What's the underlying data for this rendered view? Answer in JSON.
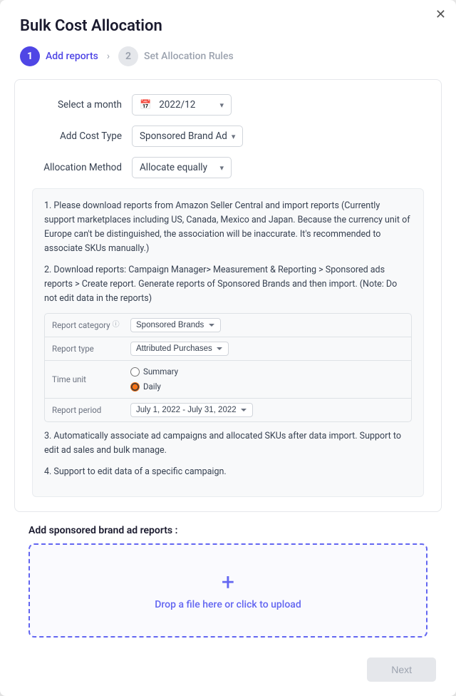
{
  "modal": {
    "title": "Bulk Cost Allocation",
    "close_label": "✕"
  },
  "steps": [
    {
      "number": "1",
      "label": "Add reports",
      "active": true
    },
    {
      "number": "2",
      "label": "Set Allocation Rules",
      "active": false
    }
  ],
  "form": {
    "select_month_label": "Select a month",
    "month_value": "2022/12",
    "add_cost_type_label": "Add Cost Type",
    "cost_type_value": "Sponsored Brand Ad",
    "allocation_method_label": "Allocation Method",
    "allocation_method_value": "Allocate equally"
  },
  "instructions": {
    "line1": "1. Please download reports from Amazon Seller Central and import reports (Currently support marketplaces including US, Canada, Mexico and Japan. Because the currency unit of Europe can't be distinguished, the association will be inaccurate. It's recommended to associate SKUs manually.)",
    "line2": "2. Download reports: Campaign Manager> Measurement & Reporting > Sponsored ads reports > Create report. Generate reports of Sponsored Brands and then import. (Note: Do not edit data in the reports)",
    "line3": "3. Automatically associate ad campaigns and allocated SKUs after data import. Support to edit ad sales and bulk manage.",
    "line4": "4. Support to edit data of a specific campaign."
  },
  "mini_table": {
    "report_category_label": "Report category",
    "report_category_value": "Sponsored Brands",
    "report_type_label": "Report type",
    "report_type_value": "Attributed Purchases",
    "time_unit_label": "Time unit",
    "time_unit_summary": "Summary",
    "time_unit_daily": "Daily",
    "report_period_label": "Report period",
    "report_period_value": "July 1, 2022 - July 31, 2022"
  },
  "upload": {
    "section_label": "Add sponsored brand ad reports :",
    "plus_icon": "+",
    "text": "Drop a file here or click to upload"
  },
  "footer": {
    "next_label": "Next"
  }
}
